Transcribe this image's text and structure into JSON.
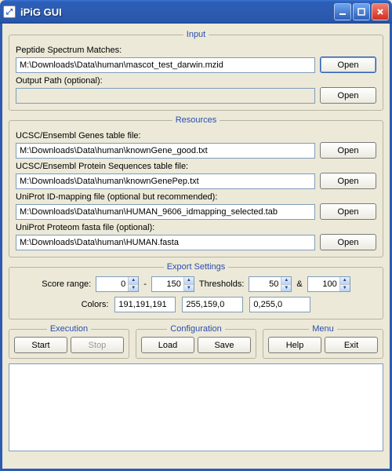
{
  "window": {
    "title": "iPiG GUI",
    "icon_glyph": "⤢"
  },
  "input": {
    "legend": "Input",
    "psm_label": "Peptide Spectrum Matches:",
    "psm_value": "M:\\Downloads\\Data\\human\\mascot_test_darwin.mzid",
    "psm_open": "Open",
    "out_label": "Output Path (optional):",
    "out_value": "",
    "out_open": "Open"
  },
  "resources": {
    "legend": "Resources",
    "genes_label": "UCSC/Ensembl Genes table file:",
    "genes_value": "M:\\Downloads\\Data\\human\\knownGene_good.txt",
    "genes_open": "Open",
    "protseq_label": "UCSC/Ensembl Protein Sequences table file:",
    "protseq_value": "M:\\Downloads\\Data\\human\\knownGenePep.txt",
    "protseq_open": "Open",
    "idmap_label": "UniProt ID-mapping file  (optional but recommended):",
    "idmap_value": "M:\\Downloads\\Data\\human\\HUMAN_9606_idmapping_selected.tab",
    "idmap_open": "Open",
    "proteom_label": "UniProt Proteom fasta file  (optional):",
    "proteom_value": "M:\\Downloads\\Data\\human\\HUMAN.fasta",
    "proteom_open": "Open"
  },
  "export": {
    "legend": "Export Settings",
    "score_label": "Score range:",
    "score_min": "0",
    "dash": "-",
    "score_max": "150",
    "thr_label": "Thresholds:",
    "thr1": "50",
    "amp": "&",
    "thr2": "100",
    "colors_label": "Colors:",
    "c1": "191,191,191",
    "c2": "255,159,0",
    "c3": "0,255,0"
  },
  "execution": {
    "legend": "Execution",
    "start": "Start",
    "stop": "Stop"
  },
  "configuration": {
    "legend": "Configuration",
    "load": "Load",
    "save": "Save"
  },
  "menu": {
    "legend": "Menu",
    "help": "Help",
    "exit": "Exit"
  },
  "log_text": ""
}
